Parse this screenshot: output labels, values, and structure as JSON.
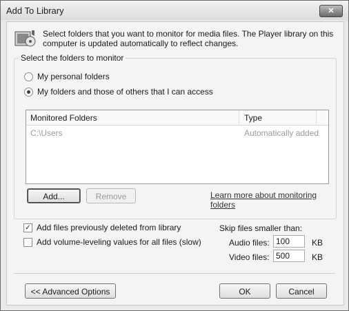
{
  "window": {
    "title": "Add To Library",
    "close_glyph": "✕"
  },
  "intro": {
    "text": "Select folders that you want to monitor for media files. The Player library on this computer is updated automatically to reflect changes.",
    "icon": "media-library-icon"
  },
  "folders_group": {
    "label": "Select the folders to monitor",
    "options": [
      {
        "label": "My personal folders",
        "checked": false
      },
      {
        "label": "My folders and those of others that I can access",
        "checked": true
      }
    ]
  },
  "list": {
    "columns": [
      "Monitored Folders",
      "Type"
    ],
    "rows": [
      {
        "folder": "C:\\Users",
        "type": "Automatically added"
      }
    ]
  },
  "buttons": {
    "add": "Add...",
    "remove": "Remove",
    "advanced": "<< Advanced Options",
    "ok": "OK",
    "cancel": "Cancel"
  },
  "learn_more_link": "Learn more about monitoring folders",
  "checkboxes": [
    {
      "label": "Add files previously deleted from library",
      "checked": true
    },
    {
      "label": "Add volume-leveling values for all files (slow)",
      "checked": false
    }
  ],
  "skip": {
    "label": "Skip files smaller than:",
    "audio": {
      "label": "Audio files:",
      "value": "100",
      "unit": "KB"
    },
    "video": {
      "label": "Video files:",
      "value": "500",
      "unit": "KB"
    }
  }
}
